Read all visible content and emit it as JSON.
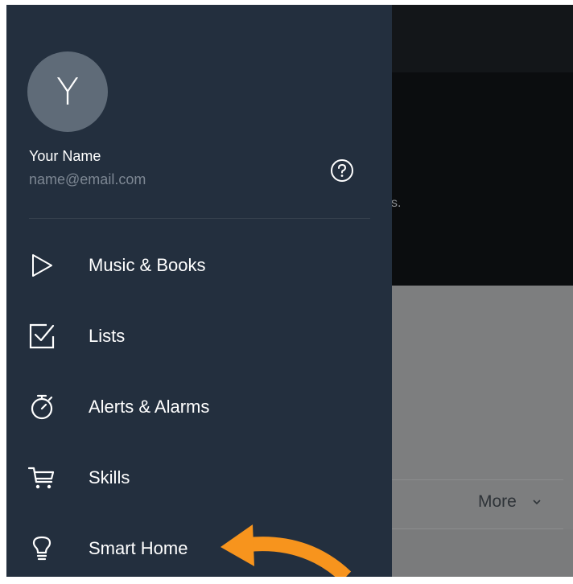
{
  "user": {
    "avatar_initial": "Y",
    "name": "Your Name",
    "email": "name@email.com"
  },
  "menu": {
    "items": [
      {
        "label": "Music & Books",
        "icon": "play-icon"
      },
      {
        "label": "Lists",
        "icon": "checkbox-icon"
      },
      {
        "label": "Alerts & Alarms",
        "icon": "stopwatch-icon"
      },
      {
        "label": "Skills",
        "icon": "cart-icon"
      },
      {
        "label": "Smart Home",
        "icon": "lightbulb-icon"
      }
    ]
  },
  "background": {
    "hero_fragment": "s.",
    "more_label": "More"
  },
  "colors": {
    "drawer_bg": "#232f3e",
    "avatar_bg": "#5f6b78",
    "annotation_arrow": "#f7941d"
  }
}
